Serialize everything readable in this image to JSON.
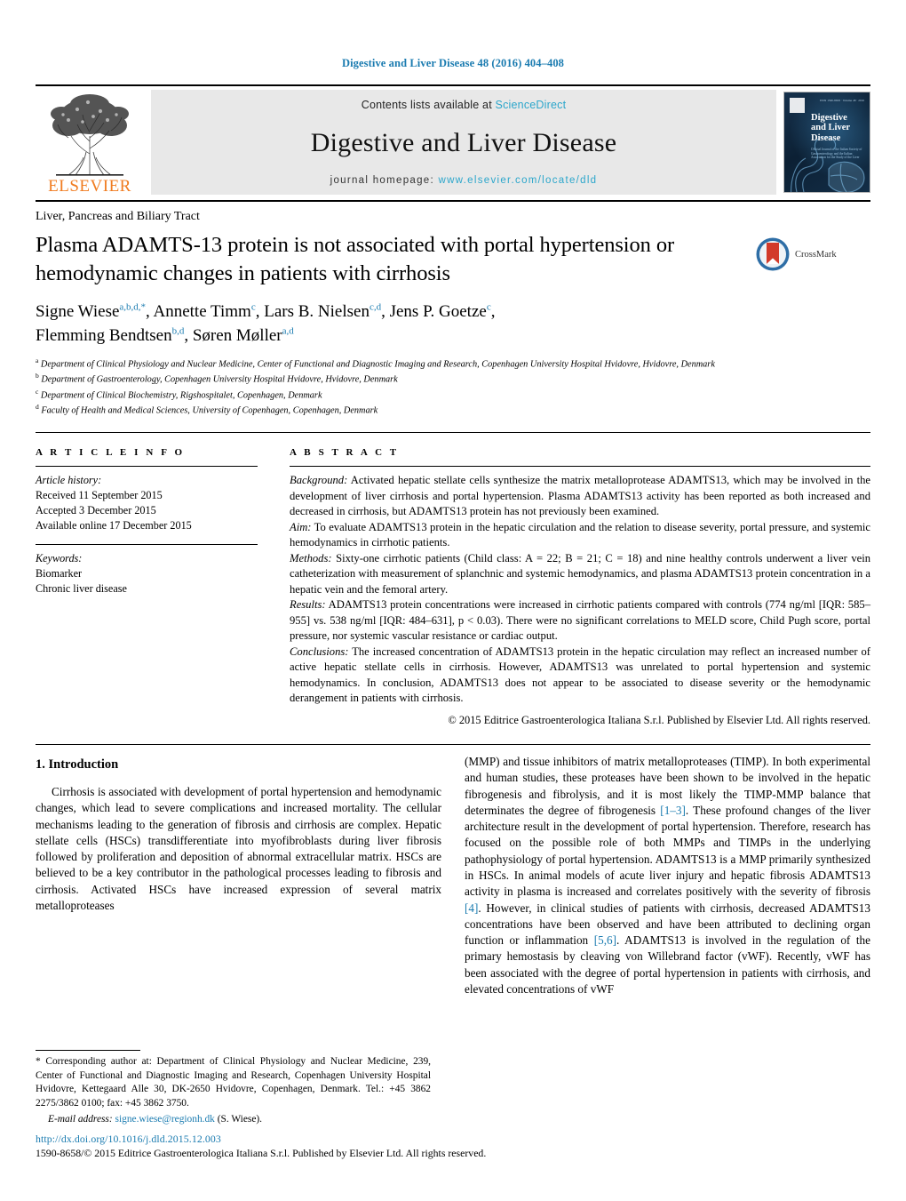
{
  "running_head": "Digestive and Liver Disease 48 (2016) 404–408",
  "masthead": {
    "contents_prefix": "Contents lists available at ",
    "contents_link": "ScienceDirect",
    "journal_title": "Digestive and Liver Disease",
    "homepage_prefix": "journal homepage: ",
    "homepage_link": "www.elsevier.com/locate/dld",
    "publisher_wordmark": "ELSEVIER",
    "cover": {
      "title_line1": "Digestive",
      "title_line2": "and Liver",
      "title_line3": "Disease",
      "subtitle": "Official Journal of the Italian Society of Gastroenterology and the Italian Association for the Study of the Liver",
      "top_text": "ISSN 1590-8658 · Volume 48 · 2016"
    },
    "link_color": "#2ba6cb"
  },
  "article": {
    "subject_section": "Liver, Pancreas and Biliary Tract",
    "title": "Plasma ADAMTS-13 protein is not associated with portal hypertension or hemodynamic changes in patients with cirrhosis",
    "crossmark_label": "CrossMark",
    "authors": [
      {
        "name": "Signe Wiese",
        "sup": "a,b,d,",
        "star": "*"
      },
      {
        "name": "Annette Timm",
        "sup": "c"
      },
      {
        "name": "Lars B. Nielsen",
        "sup": "c,d"
      },
      {
        "name": "Jens P. Goetze",
        "sup": "c"
      },
      {
        "name": "Flemming Bendtsen",
        "sup": "b,d"
      },
      {
        "name": "Søren Møller",
        "sup": "a,d"
      }
    ],
    "affiliations": [
      {
        "mark": "a",
        "text": "Department of Clinical Physiology and Nuclear Medicine, Center of Functional and Diagnostic Imaging and Research, Copenhagen University Hospital Hvidovre, Hvidovre, Denmark"
      },
      {
        "mark": "b",
        "text": "Department of Gastroenterology, Copenhagen University Hospital Hvidovre, Hvidovre, Denmark"
      },
      {
        "mark": "c",
        "text": "Department of Clinical Biochemistry, Rigshospitalet, Copenhagen, Denmark"
      },
      {
        "mark": "d",
        "text": "Faculty of Health and Medical Sciences, University of Copenhagen, Copenhagen, Denmark"
      }
    ]
  },
  "article_info": {
    "heading": "A R T I C L E   I N F O",
    "history_label": "Article history:",
    "history": [
      "Received 11 September 2015",
      "Accepted 3 December 2015",
      "Available online 17 December 2015"
    ],
    "keywords_label": "Keywords:",
    "keywords": [
      "Biomarker",
      "Chronic liver disease"
    ]
  },
  "abstract": {
    "heading": "A B S T R A C T",
    "sections": [
      {
        "label": "Background:",
        "text": " Activated hepatic stellate cells synthesize the matrix metalloprotease ADAMTS13, which may be involved in the development of liver cirrhosis and portal hypertension. Plasma ADAMTS13 activity has been reported as both increased and decreased in cirrhosis, but ADAMTS13 protein has not previously been examined."
      },
      {
        "label": "Aim:",
        "text": " To evaluate ADAMTS13 protein in the hepatic circulation and the relation to disease severity, portal pressure, and systemic hemodynamics in cirrhotic patients."
      },
      {
        "label": "Methods:",
        "text": " Sixty-one cirrhotic patients (Child class: A = 22; B = 21; C = 18) and nine healthy controls underwent a liver vein catheterization with measurement of splanchnic and systemic hemodynamics, and plasma ADAMTS13 protein concentration in a hepatic vein and the femoral artery."
      },
      {
        "label": "Results:",
        "text": " ADAMTS13 protein concentrations were increased in cirrhotic patients compared with controls (774 ng/ml [IQR: 585–955] vs. 538 ng/ml [IQR: 484–631], p < 0.03). There were no significant correlations to MELD score, Child Pugh score, portal pressure, nor systemic vascular resistance or cardiac output."
      },
      {
        "label": "Conclusions:",
        "text": " The increased concentration of ADAMTS13 protein in the hepatic circulation may reflect an increased number of active hepatic stellate cells in cirrhosis. However, ADAMTS13 was unrelated to portal hypertension and systemic hemodynamics. In conclusion, ADAMTS13 does not appear to be associated to disease severity or the hemodynamic derangement in patients with cirrhosis."
      }
    ],
    "copyright": "© 2015 Editrice Gastroenterologica Italiana S.r.l. Published by Elsevier Ltd. All rights reserved."
  },
  "body": {
    "intro_heading": "1. Introduction",
    "left_paragraph": "Cirrhosis is associated with development of portal hypertension and hemodynamic changes, which lead to severe complications and increased mortality. The cellular mechanisms leading to the generation of fibrosis and cirrhosis are complex. Hepatic stellate cells (HSCs) transdifferentiate into myofibroblasts during liver fibrosis followed by proliferation and deposition of abnormal extracellular matrix. HSCs are believed to be a key contributor in the pathological processes leading to fibrosis and cirrhosis. Activated HSCs have increased expression of several matrix metalloproteases",
    "right_segments": [
      {
        "type": "text",
        "value": "(MMP) and tissue inhibitors of matrix metalloproteases (TIMP). In both experimental and human studies, these proteases have been shown to be involved in the hepatic fibrogenesis and fibrolysis, and it is most likely the TIMP-MMP balance that determinates the degree of fibrogenesis "
      },
      {
        "type": "ref",
        "value": "[1–3]"
      },
      {
        "type": "text",
        "value": ". These profound changes of the liver architecture result in the development of portal hypertension. Therefore, research has focused on the possible role of both MMPs and TIMPs in the underlying pathophysiology of portal hypertension. ADAMTS13 is a MMP primarily synthesized in HSCs. In animal models of acute liver injury and hepatic fibrosis ADAMTS13 activity in plasma is increased and correlates positively with the severity of fibrosis "
      },
      {
        "type": "ref",
        "value": "[4]"
      },
      {
        "type": "text",
        "value": ". However, in clinical studies of patients with cirrhosis, decreased ADAMTS13 concentrations have been observed and have been attributed to declining organ function or inflammation "
      },
      {
        "type": "ref",
        "value": "[5,6]"
      },
      {
        "type": "text",
        "value": ". ADAMTS13 is involved in the regulation of the primary hemostasis by cleaving von Willebrand factor (vWF). Recently, vWF has been associated with the degree of portal hypertension in patients with cirrhosis, and elevated concentrations of vWF"
      }
    ]
  },
  "footnote": {
    "star": "*",
    "text": " Corresponding author at: Department of Clinical Physiology and Nuclear Medicine, 239, Center of Functional and Diagnostic Imaging and Research, Copenhagen University Hospital Hvidovre, Kettegaard Alle 30, DK-2650 Hvidovre, Copenhagen, Denmark. Tel.: +45 3862 2275/3862 0100; fax: +45 3862 3750.",
    "email_label": "E-mail address:",
    "email": "signe.wiese@regionh.dk",
    "email_owner": "(S. Wiese)."
  },
  "page_footer": {
    "doi": "http://dx.doi.org/10.1016/j.dld.2015.12.003",
    "issn_line": "1590-8658/© 2015 Editrice Gastroenterologica Italiana S.r.l. Published by Elsevier Ltd. All rights reserved."
  }
}
